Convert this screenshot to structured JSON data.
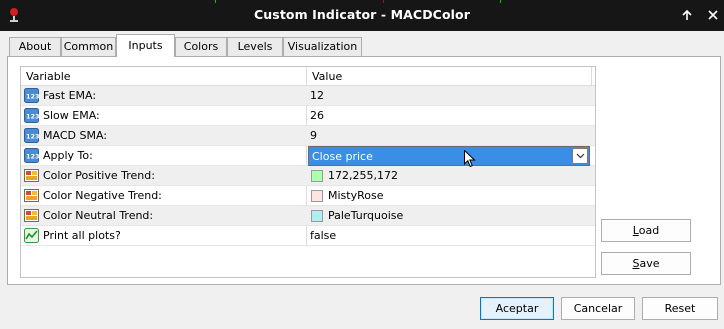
{
  "window": {
    "title": "Custom Indicator - MACDColor",
    "icons": {
      "app": "mt-app-icon",
      "help": "help-arrow-icon",
      "close": "close-icon"
    }
  },
  "tabs": [
    {
      "label": "About",
      "active": false
    },
    {
      "label": "Common",
      "active": false
    },
    {
      "label": "Inputs",
      "active": true
    },
    {
      "label": "Colors",
      "active": false
    },
    {
      "label": "Levels",
      "active": false
    },
    {
      "label": "Visualization",
      "active": false
    }
  ],
  "grid": {
    "columns": [
      "Variable",
      "Value"
    ],
    "rows": [
      {
        "icon": "number-123-icon",
        "name": "Fast EMA:",
        "value": "12"
      },
      {
        "icon": "number-123-icon",
        "name": "Slow EMA:",
        "value": "26"
      },
      {
        "icon": "number-123-icon",
        "name": "MACD SMA:",
        "value": "9"
      },
      {
        "icon": "number-123-icon",
        "name": "Apply To:",
        "value": "Close price",
        "editor": "combo"
      },
      {
        "icon": "color-palette-icon",
        "name": "Color Positive Trend:",
        "value": "172,255,172",
        "swatch": "#acffac"
      },
      {
        "icon": "color-palette-icon",
        "name": "Color Negative Trend:",
        "value": "MistyRose",
        "swatch": "#ffe4e1"
      },
      {
        "icon": "color-palette-icon",
        "name": "Color Neutral Trend:",
        "value": "PaleTurquoise",
        "swatch": "#afeeee"
      },
      {
        "icon": "plot-toggle-icon",
        "name": "Print all plots?",
        "value": "false"
      }
    ]
  },
  "side_buttons": {
    "load_prefix": "",
    "load_accel": "L",
    "load_rest": "oad",
    "save_prefix": "",
    "save_accel": "S",
    "save_rest": "ave"
  },
  "footer": {
    "accept": "Aceptar",
    "cancel": "Cancelar",
    "reset": "Reset"
  },
  "colors": {
    "titlebar": "#161616",
    "selection": "#3a8ee6",
    "row_alt": "#efefef",
    "default_button_border": "#0078d7"
  }
}
